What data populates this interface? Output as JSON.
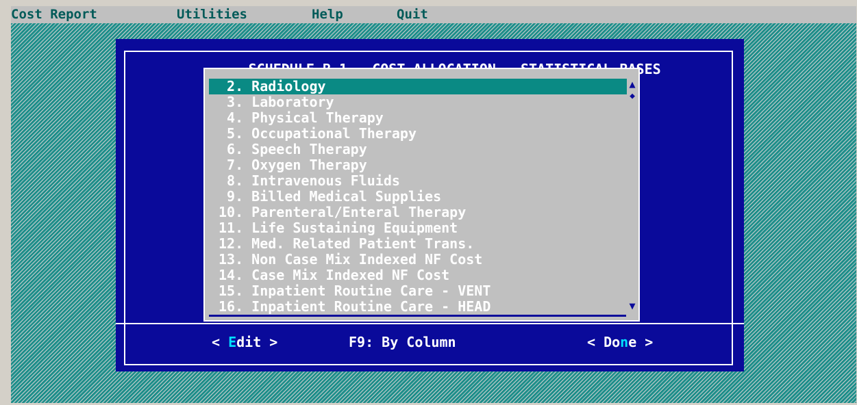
{
  "menubar": {
    "items": [
      "Cost Report",
      "Utilities",
      "Help",
      "Quit"
    ]
  },
  "dialog": {
    "title": "SCHEDULE B-1 - COST ALLOCATION - STATISTICAL BASES",
    "list": {
      "selected_index": 0,
      "items": [
        " 2. Radiology",
        " 3. Laboratory",
        " 4. Physical Therapy",
        " 5. Occupational Therapy",
        " 6. Speech Therapy",
        " 7. Oxygen Therapy",
        " 8. Intravenous Fluids",
        " 9. Billed Medical Supplies",
        "10. Parenteral/Enteral Therapy",
        "11. Life Sustaining Equipment",
        "12. Med. Related Patient Trans.",
        "13. Non Case Mix Indexed NF Cost",
        "14. Case Mix Indexed NF Cost",
        "15. Inpatient Routine Care - VENT",
        "16. Inpatient Routine Care - HEAD"
      ]
    },
    "buttons": {
      "edit": {
        "pre": "< ",
        "hot": "E",
        "post": "dit >"
      },
      "f9_label": "F9: By Column",
      "done": {
        "pre": "< Do",
        "hot": "n",
        "post": "e >"
      }
    }
  },
  "colors": {
    "desktop": "#2a9e9a",
    "menubar": "#c0c0c0",
    "menu_text": "#005a58",
    "dialog": "#0a0a9a",
    "list_bg": "#c0c0c0",
    "selection": "#0a8a84",
    "hotkey": "#00e0ff"
  }
}
